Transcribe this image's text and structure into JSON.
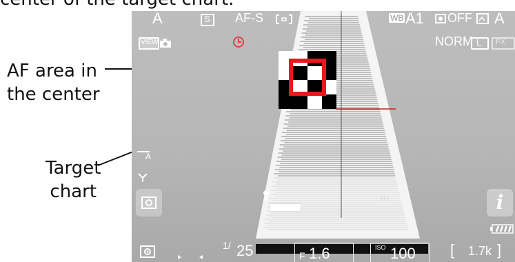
{
  "caption": "center of the target chart.",
  "callouts": {
    "af_area": "AF area in\nthe center",
    "af_area_line1": "AF area in",
    "af_area_line2": "the center",
    "target_chart_line1": "Target",
    "target_chart_line2": "chart"
  },
  "viewfinder": {
    "top_left": {
      "shooting_mode": "A",
      "release_mode": "S",
      "focus_mode": "AF-S",
      "af_area_mode_icon": "af-area-bracket-icon"
    },
    "top_right": {
      "white_balance_label": "WB",
      "white_balance_value": "A1",
      "active_dlighting": "OFF",
      "picture_control": "A",
      "image_quality": "NORM",
      "image_size": "L",
      "image_area": "FX"
    },
    "second_row": {
      "view_mode": "VIEW",
      "timer_icon": "clock-icon"
    },
    "bottom": {
      "metering_icon": "matrix-metering-icon",
      "shutter_prefix": "1/",
      "shutter_speed": "25",
      "aperture_prefix": "F",
      "aperture": "1.6",
      "iso_label": "ISO",
      "iso": "100",
      "remaining_shots": "1.7k"
    },
    "colors": {
      "af_frame": "#e8191b",
      "hud_text": "#ffffff",
      "screen_bg": "#b9b9b9",
      "crosshair": "#cc2020"
    }
  }
}
